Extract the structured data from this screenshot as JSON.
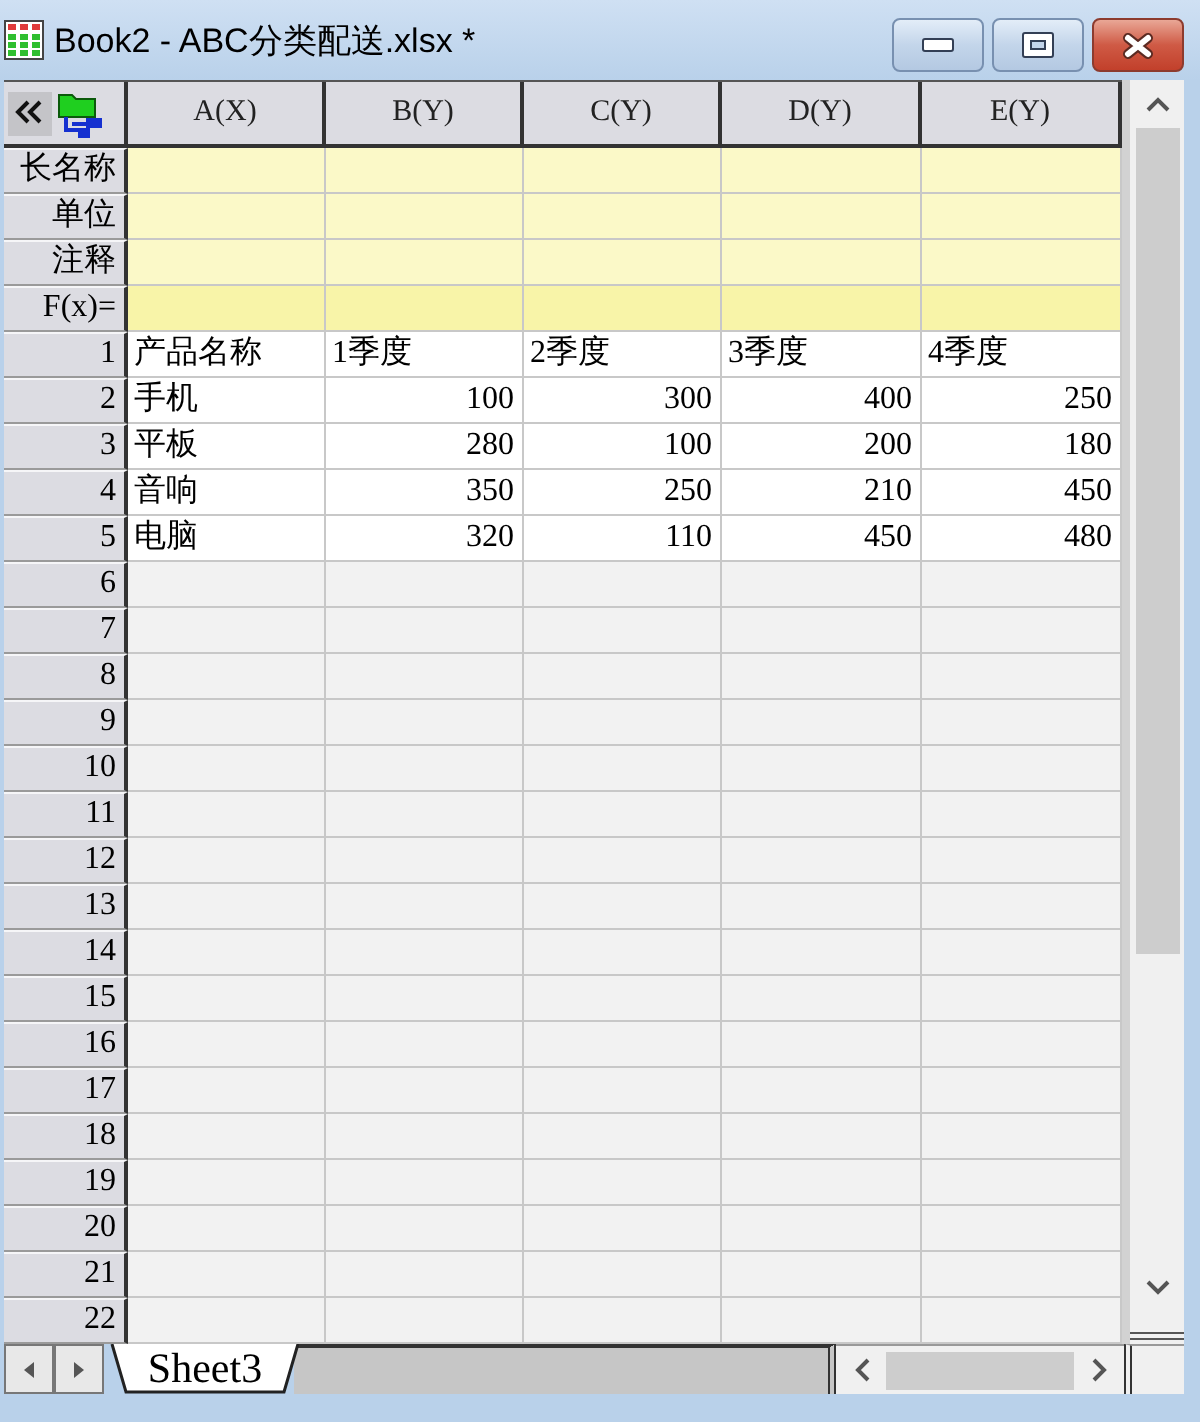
{
  "window": {
    "title": "Book2 - ABC分类配送.xlsx *"
  },
  "columns": [
    "A(X)",
    "B(Y)",
    "C(Y)",
    "D(Y)",
    "E(Y)"
  ],
  "label_rows": [
    {
      "label": "长名称",
      "kind": "meta"
    },
    {
      "label": "单位",
      "kind": "meta"
    },
    {
      "label": "注释",
      "kind": "meta"
    },
    {
      "label": "F(x)=",
      "kind": "formula"
    }
  ],
  "rows": [
    {
      "number": "1",
      "cells": [
        {
          "text": "产品名称",
          "kind": "text"
        },
        {
          "text": "1季度",
          "kind": "text"
        },
        {
          "text": "2季度",
          "kind": "text"
        },
        {
          "text": "3季度",
          "kind": "text"
        },
        {
          "text": "4季度",
          "kind": "text"
        }
      ]
    },
    {
      "number": "2",
      "cells": [
        {
          "text": "手机",
          "kind": "text"
        },
        {
          "text": "100",
          "kind": "number"
        },
        {
          "text": "300",
          "kind": "number"
        },
        {
          "text": "400",
          "kind": "number"
        },
        {
          "text": "250",
          "kind": "number"
        }
      ]
    },
    {
      "number": "3",
      "cells": [
        {
          "text": "平板",
          "kind": "text"
        },
        {
          "text": "280",
          "kind": "number"
        },
        {
          "text": "100",
          "kind": "number"
        },
        {
          "text": "200",
          "kind": "number"
        },
        {
          "text": "180",
          "kind": "number"
        }
      ]
    },
    {
      "number": "4",
      "cells": [
        {
          "text": "音响",
          "kind": "text"
        },
        {
          "text": "350",
          "kind": "number"
        },
        {
          "text": "250",
          "kind": "number"
        },
        {
          "text": "210",
          "kind": "number"
        },
        {
          "text": "450",
          "kind": "number"
        }
      ]
    },
    {
      "number": "5",
      "cells": [
        {
          "text": "电脑",
          "kind": "text"
        },
        {
          "text": "320",
          "kind": "number"
        },
        {
          "text": "110",
          "kind": "number"
        },
        {
          "text": "450",
          "kind": "number"
        },
        {
          "text": "480",
          "kind": "number"
        }
      ]
    }
  ],
  "empty_rows": [
    "6",
    "7",
    "8",
    "9",
    "10",
    "11",
    "12",
    "13",
    "14",
    "15",
    "16",
    "17",
    "18",
    "19",
    "20",
    "21",
    "22"
  ],
  "sheet_tabs": [
    {
      "label": "Sheet3",
      "selected": true
    }
  ]
}
